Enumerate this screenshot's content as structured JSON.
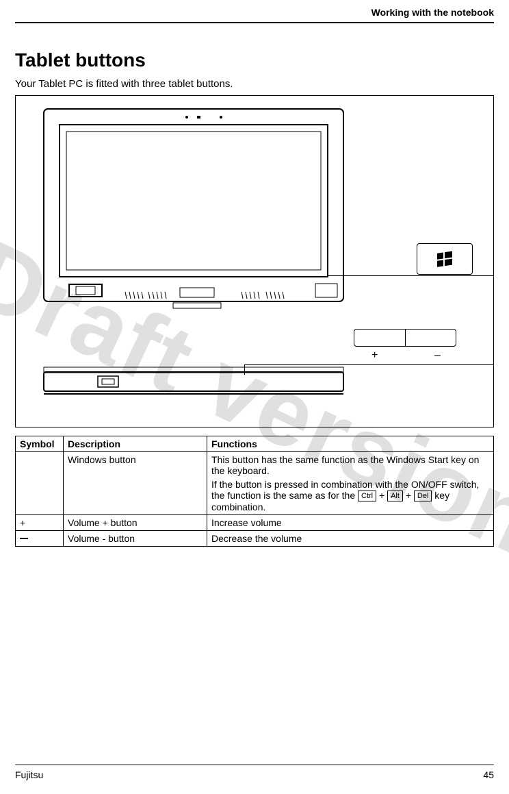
{
  "header": {
    "title": "Working with the notebook"
  },
  "page": {
    "heading": "Tablet buttons",
    "intro": "Your Tablet PC is fitted with three tablet buttons."
  },
  "callouts": {
    "vol_plus": "+",
    "vol_minus": "–"
  },
  "table": {
    "headers": {
      "symbol": "Symbol",
      "description": "Description",
      "functions": "Functions"
    },
    "rows": [
      {
        "symbol_text": "",
        "description": "Windows button",
        "function_line1": "This button has the same function as the Windows Start key on the keyboard.",
        "function_line2a": "If the button is pressed in combination with the ON/OFF switch, the function is the same as for the ",
        "key1": "Ctrl",
        "plus1": " + ",
        "key2": "Alt",
        "plus2": " + ",
        "key3": "Del",
        "function_line2b": " key combination."
      },
      {
        "symbol_text": "+",
        "description": "Volume + button",
        "function_line1": "Increase volume"
      },
      {
        "symbol_text": "minus",
        "description": "Volume - button",
        "function_line1": "Decrease the volume"
      }
    ]
  },
  "watermark": "Draft version",
  "footer": {
    "brand": "Fujitsu",
    "page_number": "45"
  }
}
